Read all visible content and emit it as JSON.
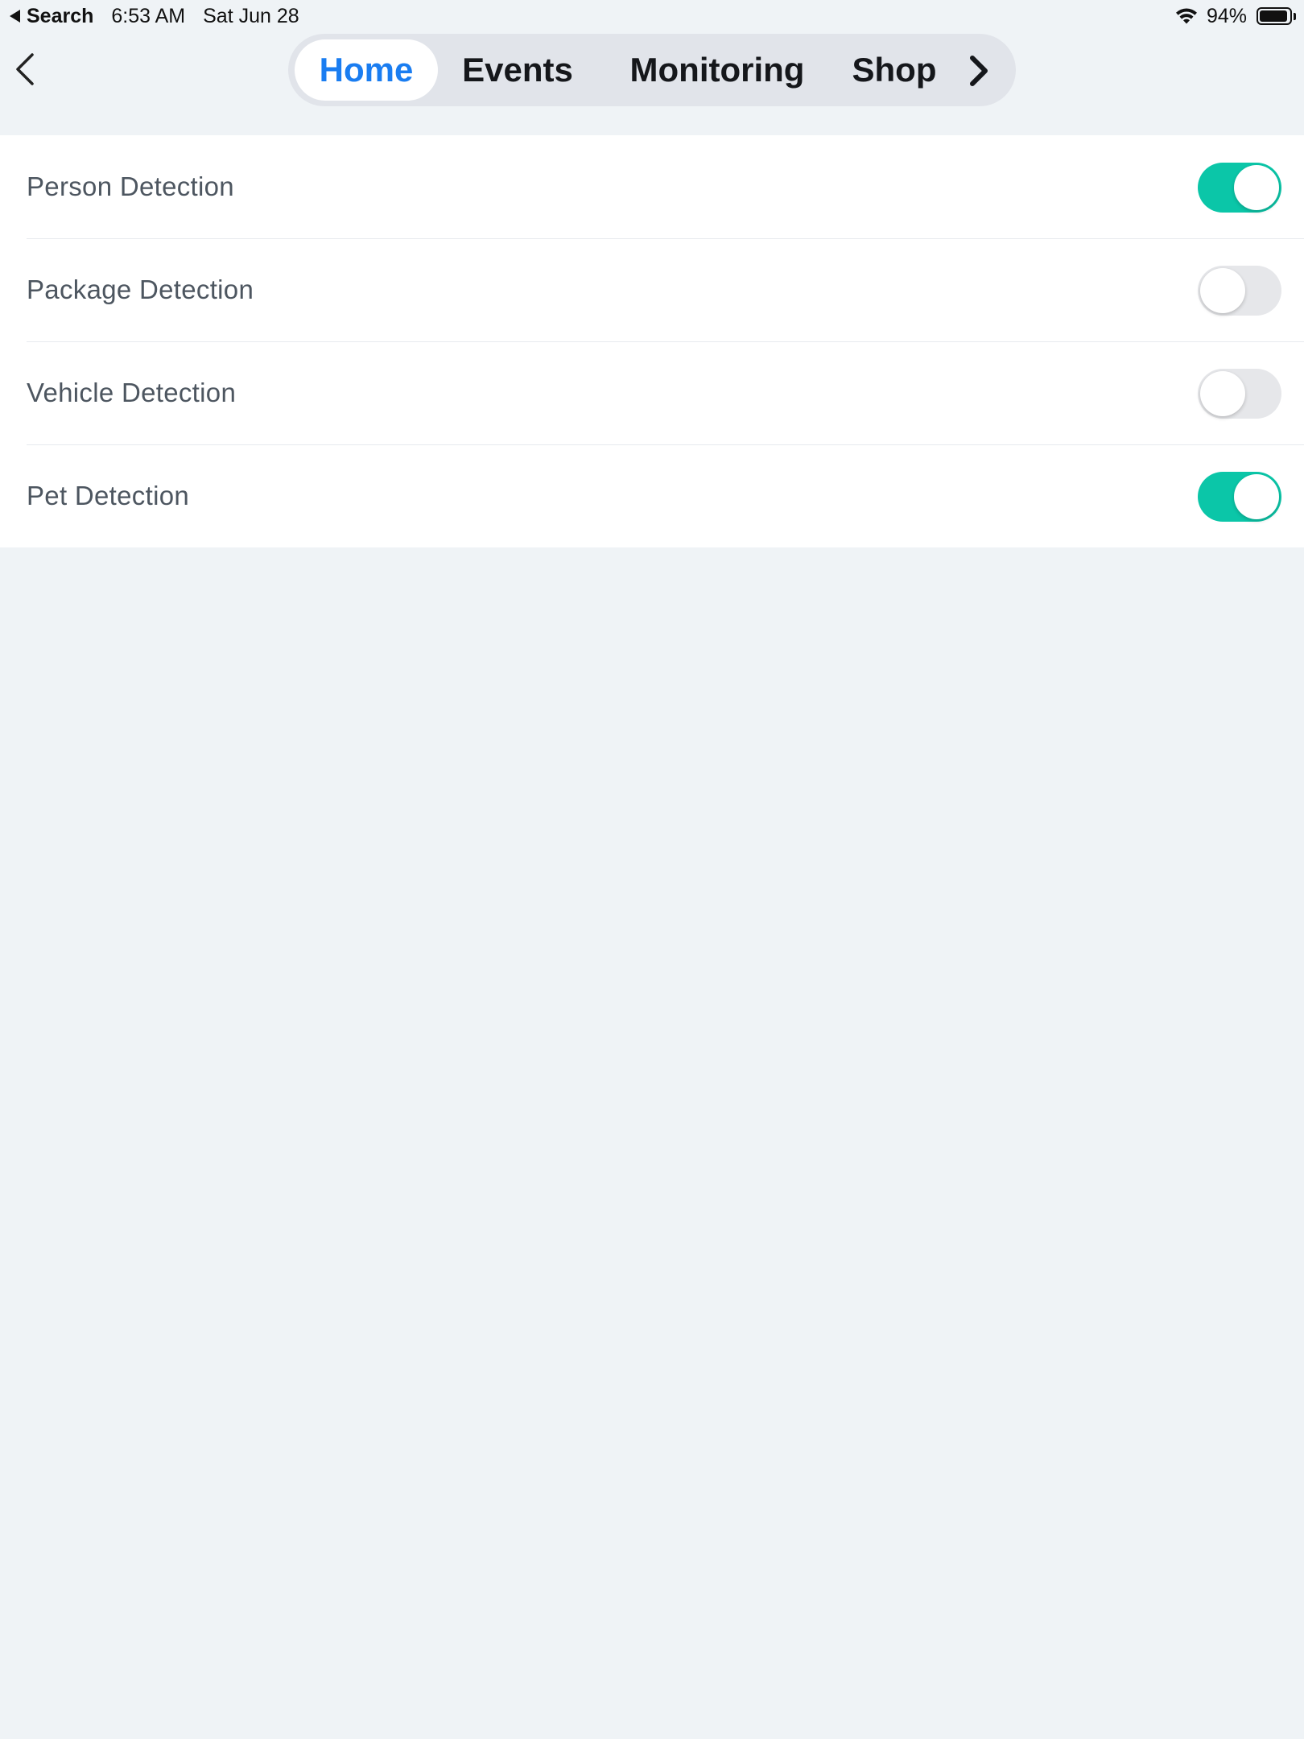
{
  "status_bar": {
    "back_app_label": "Search",
    "time": "6:53 AM",
    "date": "Sat Jun 28",
    "battery_percent_text": "94%",
    "battery_level": 0.94
  },
  "nav": {
    "tabs": [
      {
        "label": "Home",
        "active": true
      },
      {
        "label": "Events",
        "active": false
      },
      {
        "label": "Monitoring",
        "active": false
      },
      {
        "label": "Shop",
        "active": false
      }
    ]
  },
  "settings": {
    "items": [
      {
        "label": "Person Detection",
        "enabled": true
      },
      {
        "label": "Package Detection",
        "enabled": false
      },
      {
        "label": "Vehicle Detection",
        "enabled": false
      },
      {
        "label": "Pet Detection",
        "enabled": true
      }
    ]
  },
  "colors": {
    "accent_blue": "#1a7df1",
    "toggle_on": "#0bc6a8",
    "toggle_off": "#e6e7ea",
    "background": "#eff3f6"
  },
  "icons": {
    "back": "chevron-left-icon",
    "next": "chevron-right-icon",
    "wifi": "wifi-icon",
    "battery": "battery-icon"
  }
}
